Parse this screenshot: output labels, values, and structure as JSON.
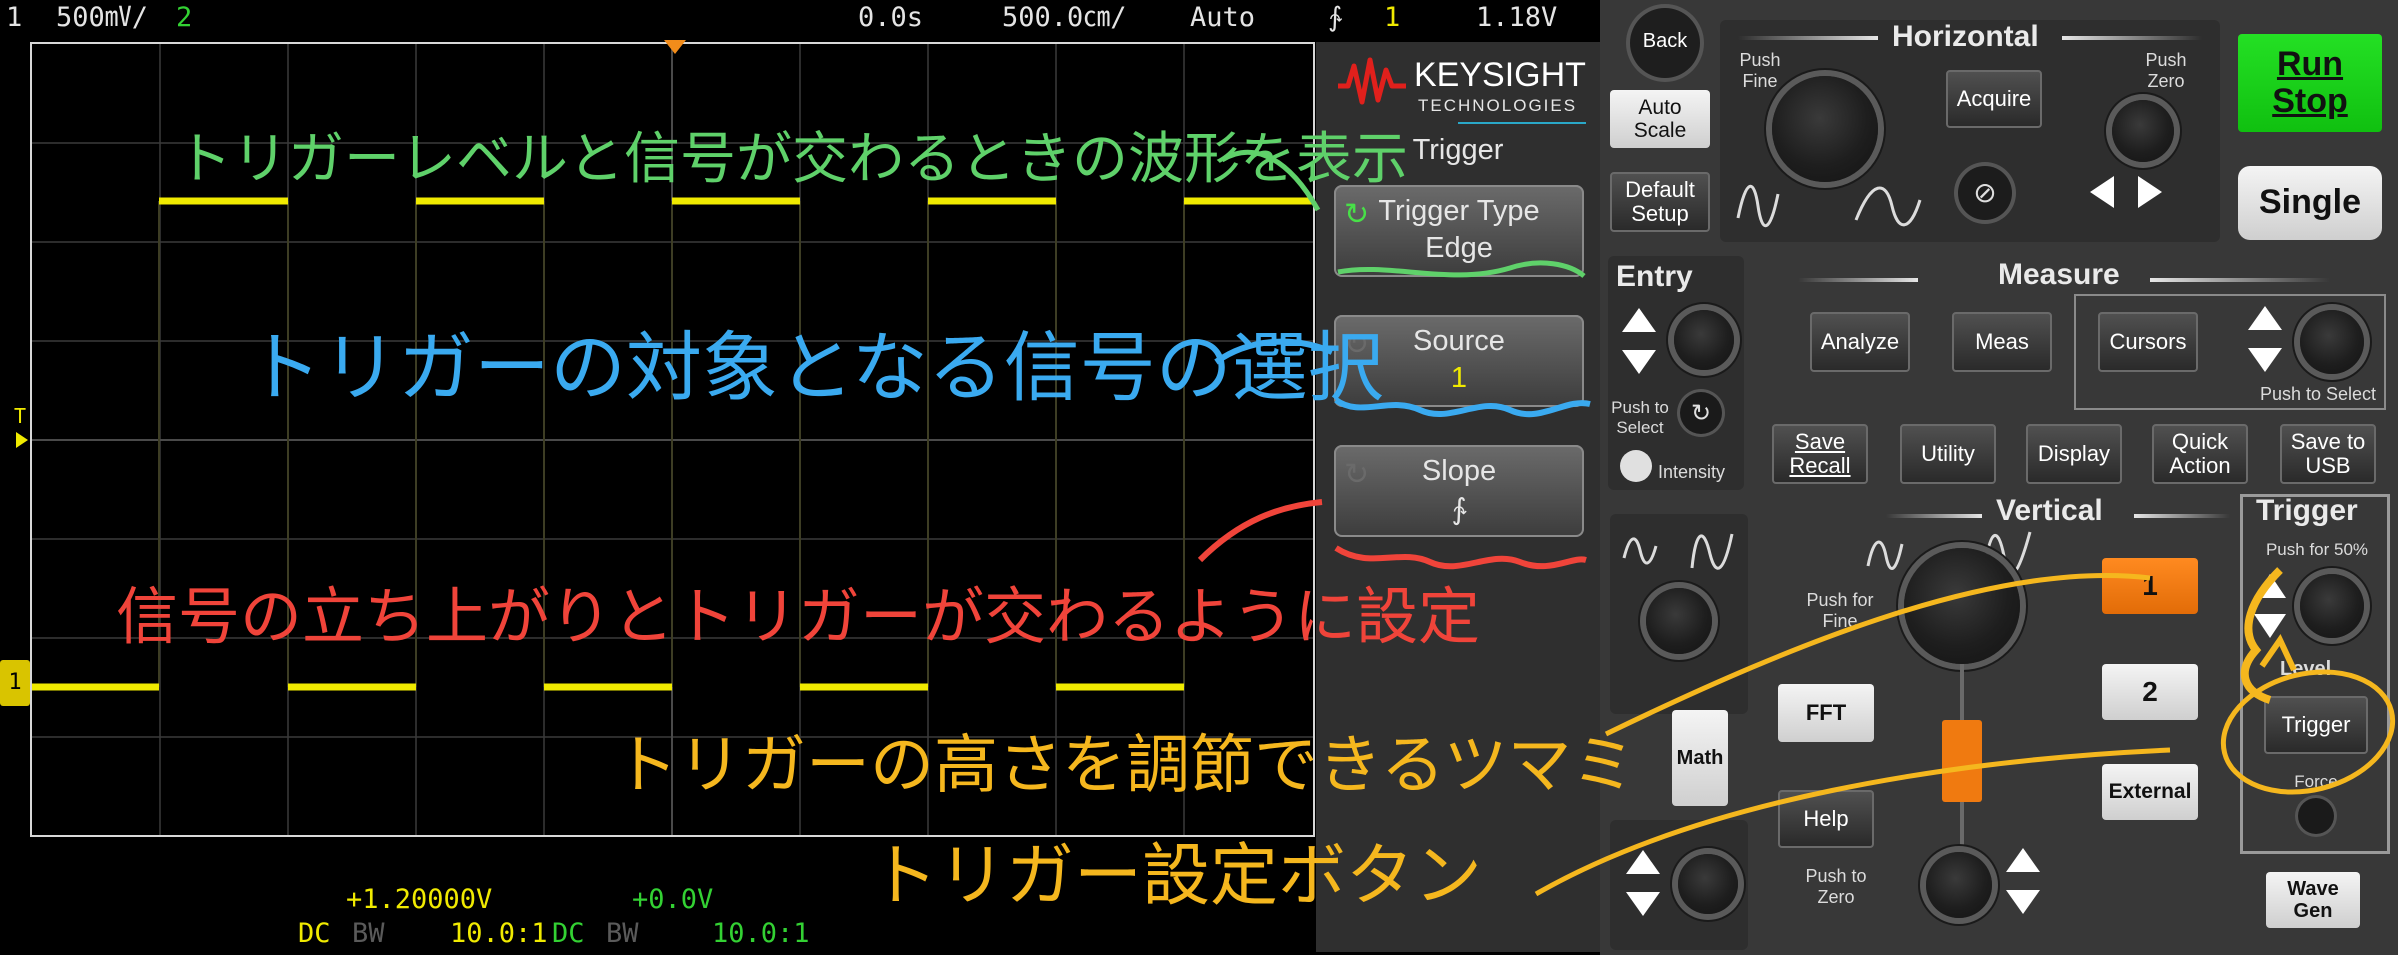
{
  "status_bar": {
    "ch1_num": "1",
    "ch1_scale": "500㎷/",
    "ch2_num": "2",
    "time_offset": "0.0s",
    "time_scale": "500.0㎝/",
    "trigger_mode": "Auto",
    "slope_symbol": "∱",
    "trigger_source": "1",
    "trigger_level": "1.18V"
  },
  "bottom_bar": {
    "ch1_offset": "+1.20000V",
    "ch2_offset": "+0.0V",
    "ch1_coupling": "DC",
    "ch1_bw": "BW",
    "ch1_probe": "10.0:1",
    "ch2_coupling": "DC",
    "ch2_bw": "BW",
    "ch2_probe": "10.0:1"
  },
  "markers": {
    "trigger_level": "T",
    "ch1_ground": "1"
  },
  "softkeys": {
    "brand": "KEYSIGHT",
    "brand_sub": "TECHNOLOGIES",
    "menu_title": "Trigger",
    "keys": [
      {
        "label": "Trigger Type",
        "value": "Edge"
      },
      {
        "label": "Source",
        "value": "1"
      },
      {
        "label": "Slope",
        "value": "∱"
      }
    ]
  },
  "panel": {
    "back": "Back",
    "auto_scale": "Auto Scale",
    "default_setup": "Default Setup",
    "horizontal_title": "Horizontal",
    "push_fine": "Push Fine",
    "acquire": "Acquire",
    "push_zero": "Push Zero",
    "run_stop": "Run Stop",
    "single": "Single",
    "entry_title": "Entry",
    "push_to_select": "Push to Select",
    "intensity": "Intensity",
    "measure_title": "Measure",
    "analyze": "Analyze",
    "meas": "Meas",
    "cursors": "Cursors",
    "push_to_select2": "Push to Select",
    "save_recall": "Save Recall",
    "utility": "Utility",
    "display": "Display",
    "quick_action": "Quick Action",
    "save_usb": "Save to USB",
    "vertical_title": "Vertical",
    "push_for_fine": "Push for Fine",
    "ch1_button": "1",
    "ch2_button": "2",
    "fft": "FFT",
    "math": "Math",
    "help": "Help",
    "external": "External",
    "push_to_zero": "Push to Zero",
    "trigger_title": "Trigger",
    "push_for_50": "Push for 50%",
    "level": "Level",
    "trigger_button": "Trigger",
    "force": "Force",
    "wave_gen": "Wave Gen"
  },
  "annotations": {
    "green": "トリガーレベルと信号が交わるときの波形を表示",
    "blue": "トリガーの対象となる信号の選択",
    "red": "信号の立ち上がりとトリガーが交わるように設定",
    "orange1": "トリガーの高さを調節できるツマミ",
    "orange2": "トリガー設定ボタン"
  },
  "colors": {
    "ch1": "#f0ea00",
    "ch2": "#33d133",
    "annotation_green": "#5fd16a",
    "annotation_blue": "#3aaaf0",
    "annotation_red": "#f0443a",
    "annotation_orange": "#f5b71e",
    "run_stop_bg": "#18d418",
    "channel_1_btn": "#f07a10"
  }
}
